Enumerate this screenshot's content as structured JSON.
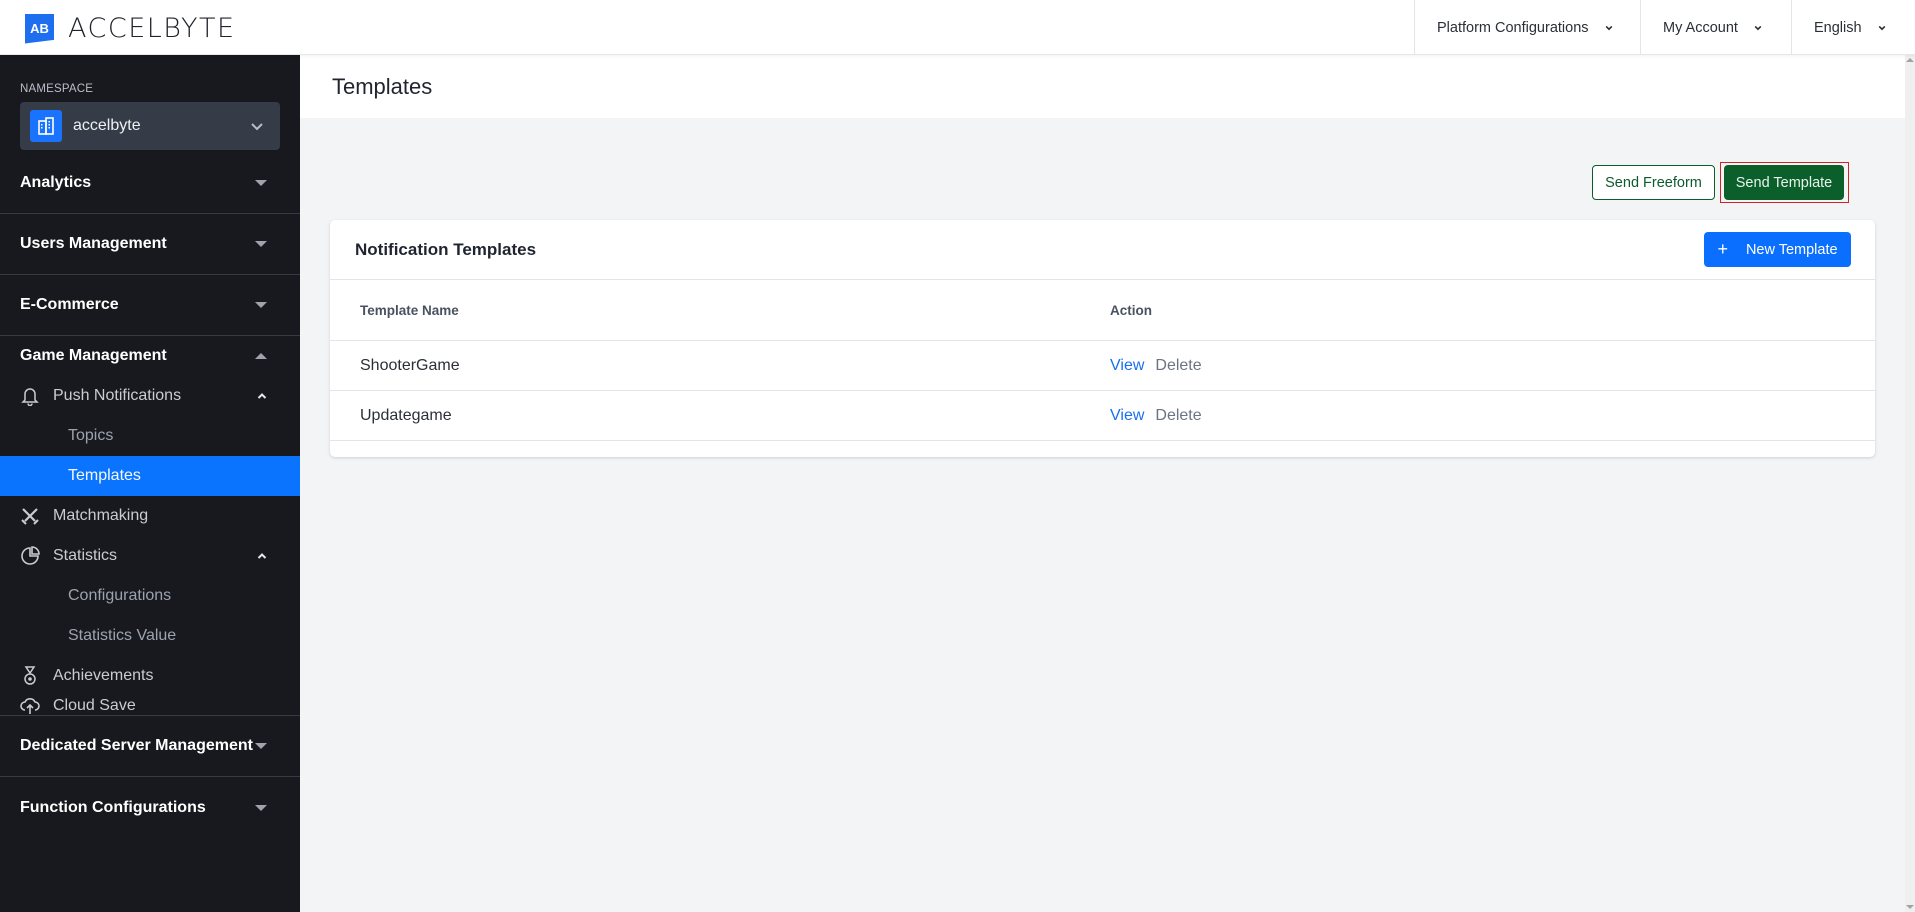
{
  "header": {
    "logo_mark": "AB",
    "logo_text": "ACCELBYTE",
    "nav": [
      {
        "label": "Platform Configurations"
      },
      {
        "label": "My Account"
      },
      {
        "label": "English"
      }
    ]
  },
  "sidebar": {
    "namespace_label": "NAMESPACE",
    "namespace_value": "accelbyte",
    "sections": {
      "analytics": "Analytics",
      "users": "Users Management",
      "ecommerce": "E-Commerce",
      "game": "Game Management",
      "dedicated": "Dedicated Server Management",
      "function": "Function Configurations"
    },
    "game_items": {
      "push": "Push Notifications",
      "topics": "Topics",
      "templates": "Templates",
      "matchmaking": "Matchmaking",
      "statistics": "Statistics",
      "configurations": "Configurations",
      "statistics_value": "Statistics Value",
      "achievements": "Achievements",
      "cloud_save": "Cloud Save"
    },
    "active_item": "Templates"
  },
  "main": {
    "page_title": "Templates",
    "actions": {
      "send_freeform": "Send Freeform",
      "send_template": "Send Template"
    },
    "card": {
      "title": "Notification Templates",
      "new_button": "New Template",
      "new_button_icon": "+",
      "columns": [
        "Template Name",
        "Action"
      ],
      "rows": [
        {
          "name": "ShooterGame",
          "view": "View",
          "delete": "Delete"
        },
        {
          "name": "Updategame",
          "view": "View",
          "delete": "Delete"
        }
      ]
    }
  },
  "colors": {
    "accent_blue": "#0a6fff",
    "active_nav": "#0a74ff",
    "send_green": "#0a5f2b",
    "highlight_red": "#d32222",
    "sidebar_bg": "#17191e"
  }
}
